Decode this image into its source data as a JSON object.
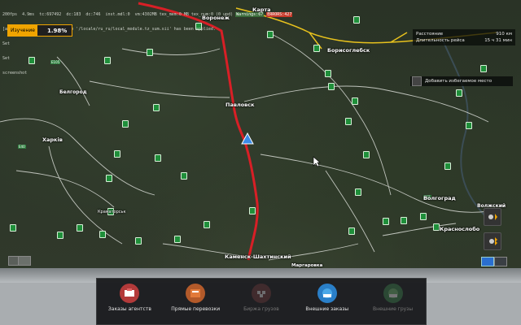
{
  "debug": {
    "line1": [
      "200fps",
      "4.9ms",
      "tc:697492",
      "dc:183",
      "dc:746",
      "inst.mdl:0",
      "vm:4302MB",
      "tex_mem:0",
      "MB",
      "tex_num:0",
      "(0 upd)"
    ],
    "badge_green": "Warnings:67",
    "badge_red": "ERRORS:427",
    "line2": "[app_lcl] Localization module '/locale/ru_ru/local_module.tz_sum.sii' has been applied.",
    "line3": "Set",
    "line4": "Set",
    "line5": "screenshot"
  },
  "progress": {
    "label": "Изучение",
    "value": "1.98%",
    "fraction": 0.0198
  },
  "route_info": {
    "distance_label": "Расстояние",
    "distance_value": "910 км",
    "duration_label": "Длительность рейса",
    "duration_value": "15 ч 31 мин"
  },
  "avoid_label": "Добавить избегаемое место",
  "cities": {
    "karta": "Карта",
    "voronezh": "Воронеж",
    "borisoglebsk": "Борисоглебск",
    "belgorod": "Белгород",
    "pavlovsk": "Павловск",
    "kharkiv": "Харків",
    "kramatorsk": "Краматорськ",
    "volgograd": "Волгоград",
    "volzhsky": "Волжский",
    "krasnoslobodsk": "Краснослобо",
    "kamensk": "Каменск-Шахтинский",
    "marzovka": "Маргаровка"
  },
  "dock": {
    "items": [
      {
        "label": "Заказы агентств",
        "icon": "agency-orders-icon",
        "enabled": true
      },
      {
        "label": "Прямые перевозки",
        "icon": "direct-transport-icon",
        "enabled": true
      },
      {
        "label": "Биржа грузов",
        "icon": "cargo-market-icon",
        "enabled": false
      },
      {
        "label": "Внешние заказы",
        "icon": "external-orders-icon",
        "enabled": true
      },
      {
        "label": "Внешние грузы",
        "icon": "external-cargo-icon",
        "enabled": false
      }
    ]
  },
  "colors": {
    "route": "#d81f26",
    "accent": "#f0a400",
    "road_yellow": "#e8c21d",
    "road_white": "#d9dcd6",
    "player": "#3a8be8"
  }
}
